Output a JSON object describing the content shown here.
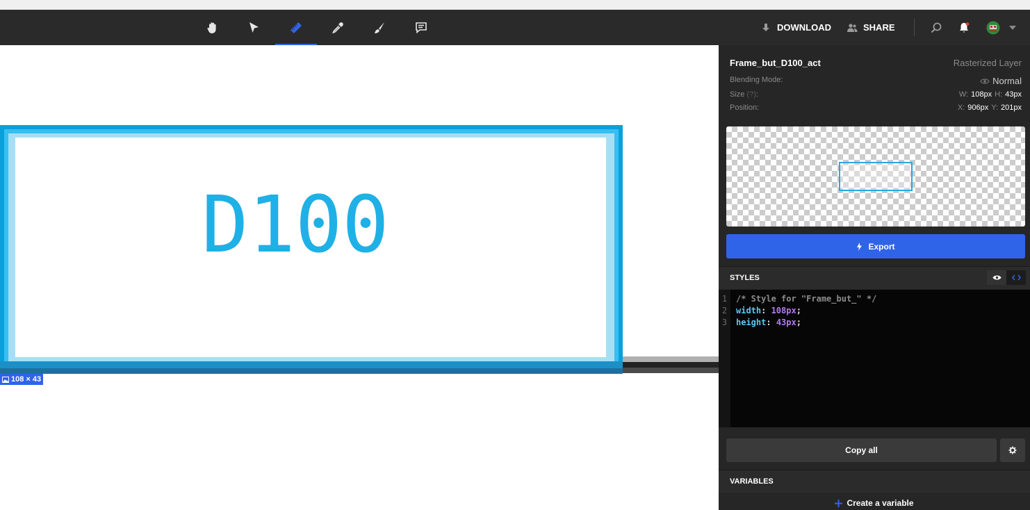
{
  "toolbar": {
    "tools": [
      {
        "name": "hand-icon"
      },
      {
        "name": "select-arrow-icon"
      },
      {
        "name": "ruler-icon",
        "active": true
      },
      {
        "name": "eyedropper-icon"
      },
      {
        "name": "brush-icon"
      },
      {
        "name": "comment-icon"
      }
    ],
    "download_label": "DOWNLOAD",
    "share_label": "SHARE",
    "accent_color": "#2f64e8"
  },
  "canvas": {
    "frame_text": "D100",
    "dimension_label": "108 × 43",
    "frame_color": "#29a8e0"
  },
  "layer": {
    "name": "Frame_but_D100_act",
    "type": "Rasterized Layer",
    "blending_label": "Blending Mode:",
    "blending_value": "Normal",
    "size_label": "Size",
    "size_help": "(?)",
    "size_colon": ":",
    "width_key": "W:",
    "width_value": "108px",
    "height_key": "H:",
    "height_value": "43px",
    "position_label": "Position:",
    "x_key": "X:",
    "x_value": "906px",
    "y_key": "Y:",
    "y_value": "201px"
  },
  "export_label": "Export",
  "styles": {
    "title": "STYLES",
    "lines": [
      {
        "num": "1",
        "comment": "/* Style for \"Frame_but_\" */"
      },
      {
        "num": "2",
        "prop": "width",
        "value": "108px"
      },
      {
        "num": "3",
        "prop": "height",
        "value": "43px"
      }
    ],
    "copy_label": "Copy all"
  },
  "variables": {
    "title": "VARIABLES",
    "create_label": "Create a variable"
  }
}
